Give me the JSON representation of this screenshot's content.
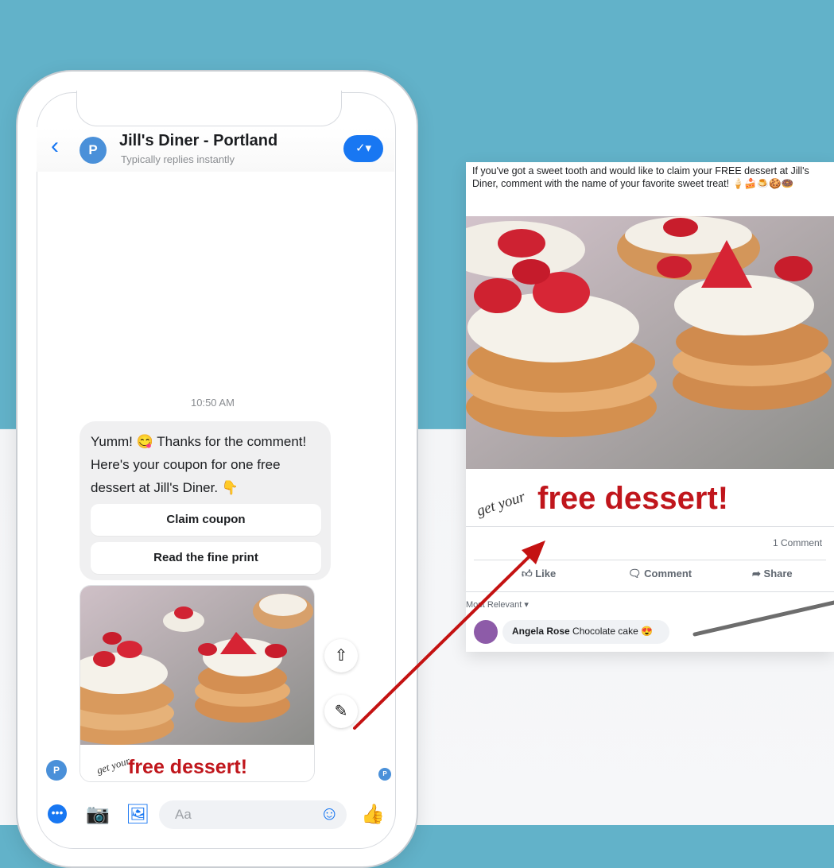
{
  "colors": {
    "brand_blue": "#1877f2",
    "teal_background": "#62b2c9",
    "promo_red": "#c0161c",
    "arrow_red": "#c41212"
  },
  "messenger": {
    "page_name": "Jill's Diner - Portland",
    "page_status": "Typically replies instantly",
    "page_avatar_letter": "P",
    "timestamp": "10:50 AM",
    "message_text": "Yumm! 😋 Thanks for the comment! Here's your coupon for one free dessert at Jill's Diner. 👇",
    "buttons": [
      "Claim coupon",
      "Read the fine print"
    ],
    "photo_script": "get your",
    "photo_headline": "free dessert!",
    "composer_placeholder": "Aa",
    "icons": [
      "back-icon",
      "check-icon",
      "share-icon",
      "edit-icon",
      "more-icon",
      "camera-icon",
      "gallery-icon",
      "emoji-icon",
      "thumbs-up-icon"
    ]
  },
  "post": {
    "caption": "If you've got a sweet tooth and would like to claim your FREE dessert at Jill's Diner, comment with the name of your favorite sweet treat! 🍦🍰🍮🍪🍩",
    "photo_script": "get your",
    "photo_headline": "free dessert!",
    "comment_count": "1 Comment",
    "actions": [
      "Like",
      "Comment",
      "Share"
    ],
    "sort_label": "Most Relevant",
    "commenter_name": "Angela Rose",
    "comment_text": "Chocolate cake 😍"
  }
}
